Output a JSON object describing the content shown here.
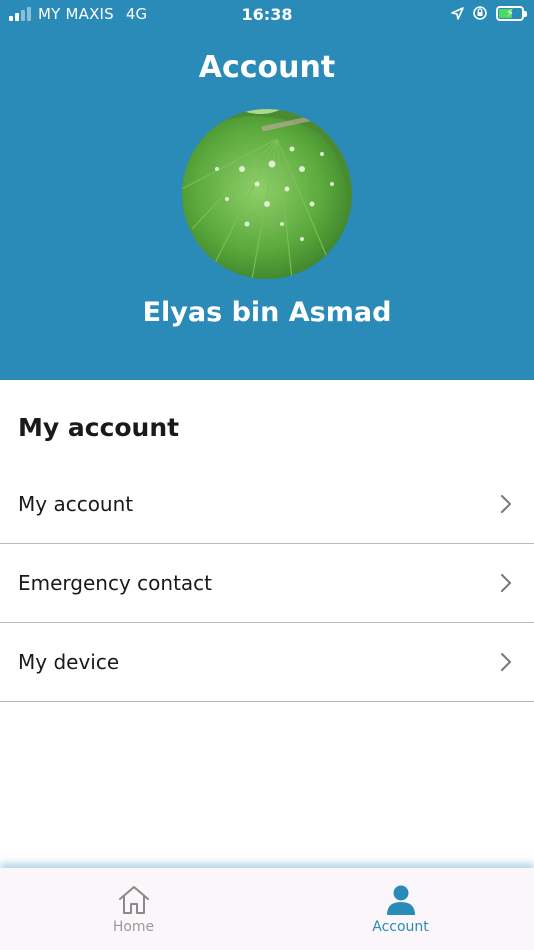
{
  "status_bar": {
    "carrier": "MY MAXIS",
    "network": "4G",
    "time": "16:38"
  },
  "header": {
    "title": "Account",
    "user_name": "Elyas bin Asmad",
    "background_color": "#2a8bb8"
  },
  "section": {
    "title": "My account"
  },
  "menu": {
    "items": [
      {
        "label": "My account",
        "icon": "chevron-right-icon"
      },
      {
        "label": "Emergency contact",
        "icon": "chevron-right-icon"
      },
      {
        "label": "My device",
        "icon": "chevron-right-icon"
      }
    ]
  },
  "tab_bar": {
    "tabs": [
      {
        "label": "Home",
        "icon": "home-icon",
        "active": false
      },
      {
        "label": "Account",
        "icon": "person-icon",
        "active": true
      }
    ],
    "active_color": "#2a8bb8",
    "inactive_color": "#9a9a9a"
  }
}
